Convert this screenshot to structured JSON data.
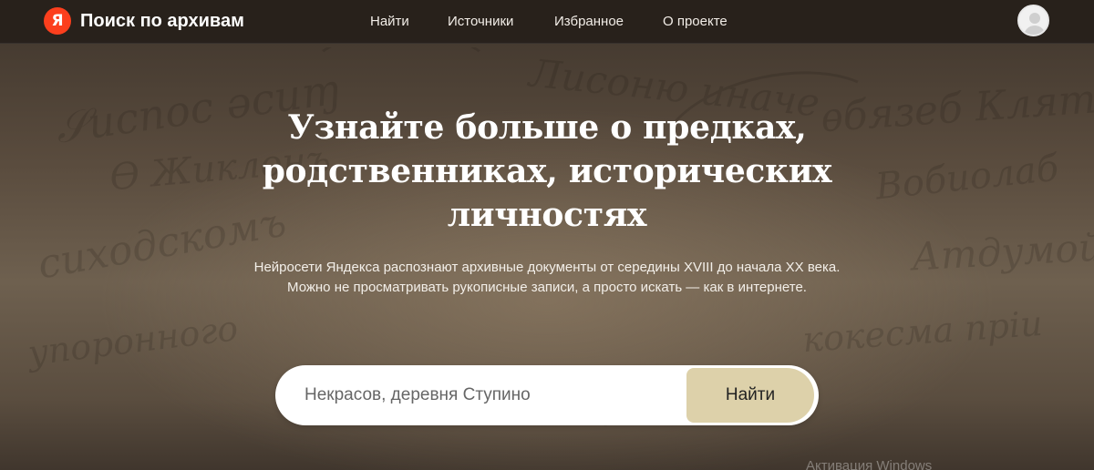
{
  "header": {
    "logo_letter": "Я",
    "title": "Поиск по архивам",
    "nav": [
      {
        "label": "Найти"
      },
      {
        "label": "Источники"
      },
      {
        "label": "Избранное"
      },
      {
        "label": "О проекте"
      }
    ],
    "avatar_icon": "user-avatar-icon"
  },
  "hero": {
    "headline_lines": [
      "Узнайте больше о предках,",
      "родственниках, исторических",
      "личностях"
    ],
    "subtext_lines": [
      "Нейросети Яндекса распознают архивные документы от середины XVIII до начала XX века.",
      "Можно не просматривать рукописные записи, а просто искать — как в интернете."
    ]
  },
  "search": {
    "placeholder": "Некрасов, деревня Ступино",
    "button_label": "Найти"
  },
  "watermark": "Активация Windows",
  "colors": {
    "logo_red": "#fc3f1d",
    "button_beige": "#ddd1aa",
    "header_bg": "#261f1a"
  }
}
